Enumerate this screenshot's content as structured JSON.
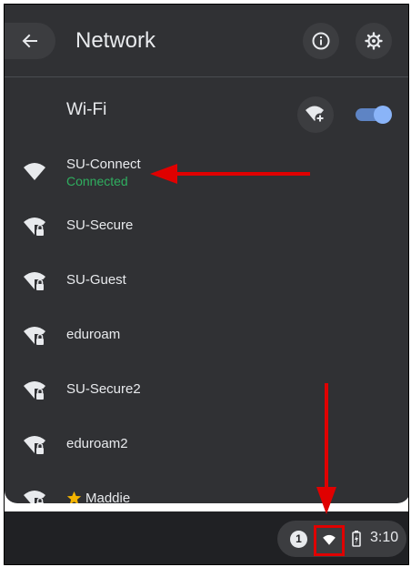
{
  "header": {
    "title": "Network"
  },
  "wifi": {
    "label": "Wi-Fi",
    "enabled": true
  },
  "networks": [
    {
      "name": "SU-Connect",
      "status": "Connected",
      "secured": false
    },
    {
      "name": "SU-Secure",
      "secured": true
    },
    {
      "name": "SU-Guest",
      "secured": true
    },
    {
      "name": "eduroam",
      "secured": true
    },
    {
      "name": "SU-Secure2",
      "secured": true
    },
    {
      "name": "eduroam2",
      "secured": true
    },
    {
      "name": "Maddie",
      "secured": true,
      "starred": true
    }
  ],
  "shelf": {
    "notification_count": "1",
    "time": "3:10"
  },
  "colors": {
    "panel": "#303134",
    "text": "#e8eaed",
    "connected": "#2fae5f",
    "accent": "#8ab4f8",
    "annotation": "#e00000"
  },
  "icons": {
    "back": "arrow-left-icon",
    "info": "info-icon",
    "settings": "gear-icon",
    "add_wifi": "wifi-add-icon",
    "wifi": "wifi-icon",
    "wifi_locked": "wifi-lock-icon",
    "star": "star-icon",
    "battery": "battery-icon"
  }
}
